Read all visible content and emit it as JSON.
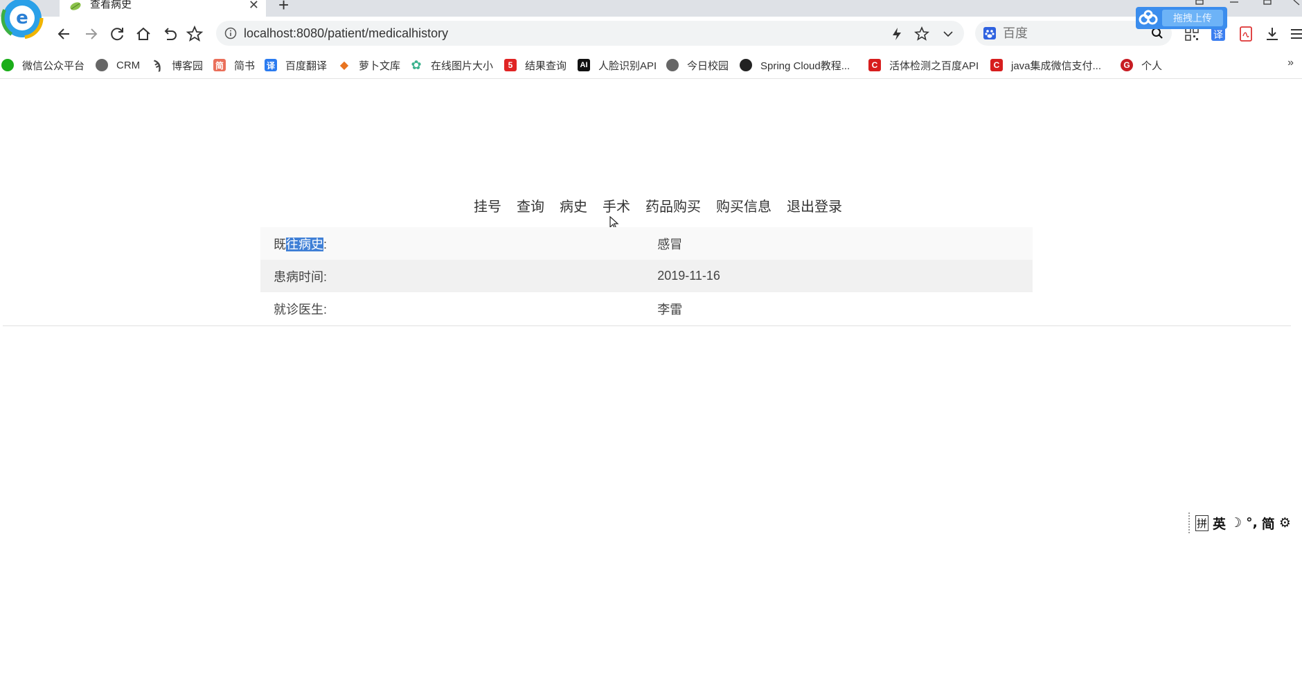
{
  "browser": {
    "tab_title": "查看病史",
    "tab_close": "✕",
    "new_tab": "+",
    "upload_label": "拖拽上传",
    "url": "localhost:8080/patient/medicalhistory",
    "search_placeholder": "百度",
    "bookmarks_more": "»"
  },
  "bookmarks": [
    {
      "label": "微信公众平台",
      "icon": "wechat-icon",
      "color": "#1aad19"
    },
    {
      "label": "CRM",
      "icon": "globe-icon",
      "color": "#555555"
    },
    {
      "label": "博客园",
      "icon": "cnblogs-icon",
      "color": "#444444"
    },
    {
      "label": "简书",
      "icon": "jianshu-icon",
      "color": "#ea6f5a",
      "glyph": "简"
    },
    {
      "label": "百度翻译",
      "icon": "baidu-translate-icon",
      "color": "#2b7bf0",
      "glyph": "译"
    },
    {
      "label": "萝卜文库",
      "icon": "carrot-icon",
      "color": "#e8731f"
    },
    {
      "label": "在线图片大小",
      "icon": "flower-icon",
      "color": "#3bb28e"
    },
    {
      "label": "结果查询",
      "icon": "five-icon",
      "color": "#e02424",
      "glyph": "5"
    },
    {
      "label": "人脸识别API",
      "icon": "ai-icon",
      "color": "#111111",
      "glyph": "AI"
    },
    {
      "label": "今日校园",
      "icon": "globe-icon",
      "color": "#555555"
    },
    {
      "label": "Spring Cloud教程...",
      "icon": "github-icon",
      "color": "#222222"
    },
    {
      "label": "活体检测之百度API",
      "icon": "csdn-icon",
      "color": "#d71e1e",
      "glyph": "C"
    },
    {
      "label": "java集成微信支付...",
      "icon": "csdn-icon",
      "color": "#d71e1e",
      "glyph": "C"
    },
    {
      "label": "个人",
      "icon": "gitee-icon",
      "color": "#c71d23",
      "glyph": "G"
    }
  ],
  "nav": {
    "items": [
      "挂号",
      "查询",
      "病史",
      "手术",
      "药品购买",
      "购买信息",
      "退出登录"
    ]
  },
  "record": {
    "history_label_pre": "既",
    "history_label_sel": "往病史",
    "history_label_post": ":",
    "history_value": "感冒",
    "date_label": "患病时间:",
    "date_value": "2019-11-16",
    "doctor_label": "就诊医生:",
    "doctor_value": "李雷"
  },
  "ime": {
    "items": [
      "拼",
      "英",
      "☽",
      "°,",
      "简",
      "⚙"
    ]
  }
}
